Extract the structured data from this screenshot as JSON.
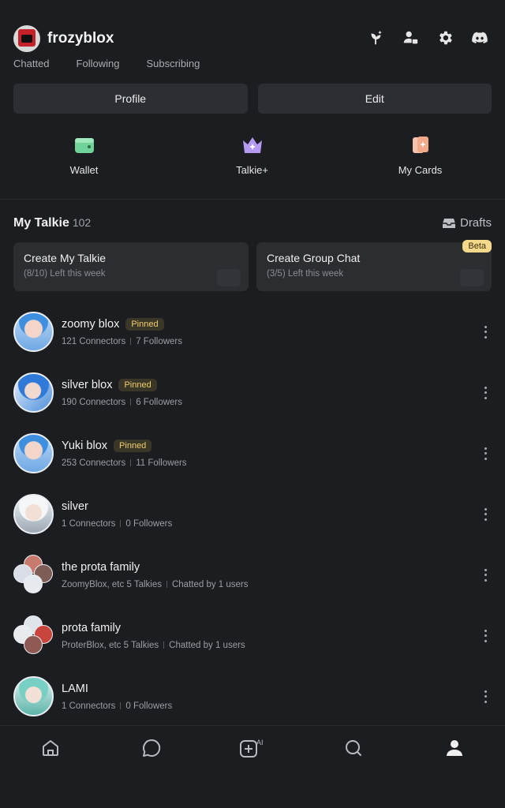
{
  "profile": {
    "username": "frozyblox",
    "stats": [
      "Chatted",
      "Following",
      "Subscribing"
    ]
  },
  "top_icons": [
    "sprout-icon",
    "person-badge-icon",
    "gear-icon",
    "discord-icon"
  ],
  "buttons": {
    "profile": "Profile",
    "edit": "Edit"
  },
  "quick_actions": [
    {
      "label": "Wallet",
      "icon": "wallet-icon",
      "color": "#6fd39a"
    },
    {
      "label": "Talkie+",
      "icon": "crown-icon",
      "color": "#b59af2"
    },
    {
      "label": "My Cards",
      "icon": "cards-icon",
      "color": "#f2a98a"
    }
  ],
  "section": {
    "title": "My Talkie",
    "count": "102",
    "drafts": "Drafts"
  },
  "create_cards": [
    {
      "title": "Create My Talkie",
      "sub": "(8/10) Left this week",
      "badge": ""
    },
    {
      "title": "Create Group Chat",
      "sub": "(3/5) Left this week",
      "badge": "Beta"
    }
  ],
  "talkies": [
    {
      "name": "zoomy blox",
      "pinned": "Pinned",
      "meta1": "121 Connectors",
      "meta2": "7 Followers",
      "avatar": "blue"
    },
    {
      "name": "silver blox",
      "pinned": "Pinned",
      "meta1": "190 Connectors",
      "meta2": "6 Followers",
      "avatar": "blue2"
    },
    {
      "name": "Yuki blox",
      "pinned": "Pinned",
      "meta1": "253 Connectors",
      "meta2": "11 Followers",
      "avatar": "blue"
    },
    {
      "name": "silver",
      "pinned": "",
      "meta1": "1 Connectors",
      "meta2": "0 Followers",
      "avatar": "white"
    },
    {
      "name": "the prota family",
      "pinned": "",
      "meta1": "ZoomyBlox, etc 5 Talkies",
      "meta2": "Chatted by 1 users",
      "avatar": "group"
    },
    {
      "name": "prota family",
      "pinned": "",
      "meta1": "ProterBlox, etc 5 Talkies",
      "meta2": "Chatted by 1 users",
      "avatar": "group"
    },
    {
      "name": "LAMI",
      "pinned": "",
      "meta1": "1 Connectors",
      "meta2": "0 Followers",
      "avatar": "teal"
    }
  ],
  "bottom_nav": [
    {
      "icon": "home-icon",
      "active": false
    },
    {
      "icon": "chat-bubble-icon",
      "active": false
    },
    {
      "icon": "create-ai-icon",
      "active": false,
      "badge": "AI"
    },
    {
      "icon": "search-icon",
      "active": false
    },
    {
      "icon": "profile-icon",
      "active": true
    }
  ]
}
